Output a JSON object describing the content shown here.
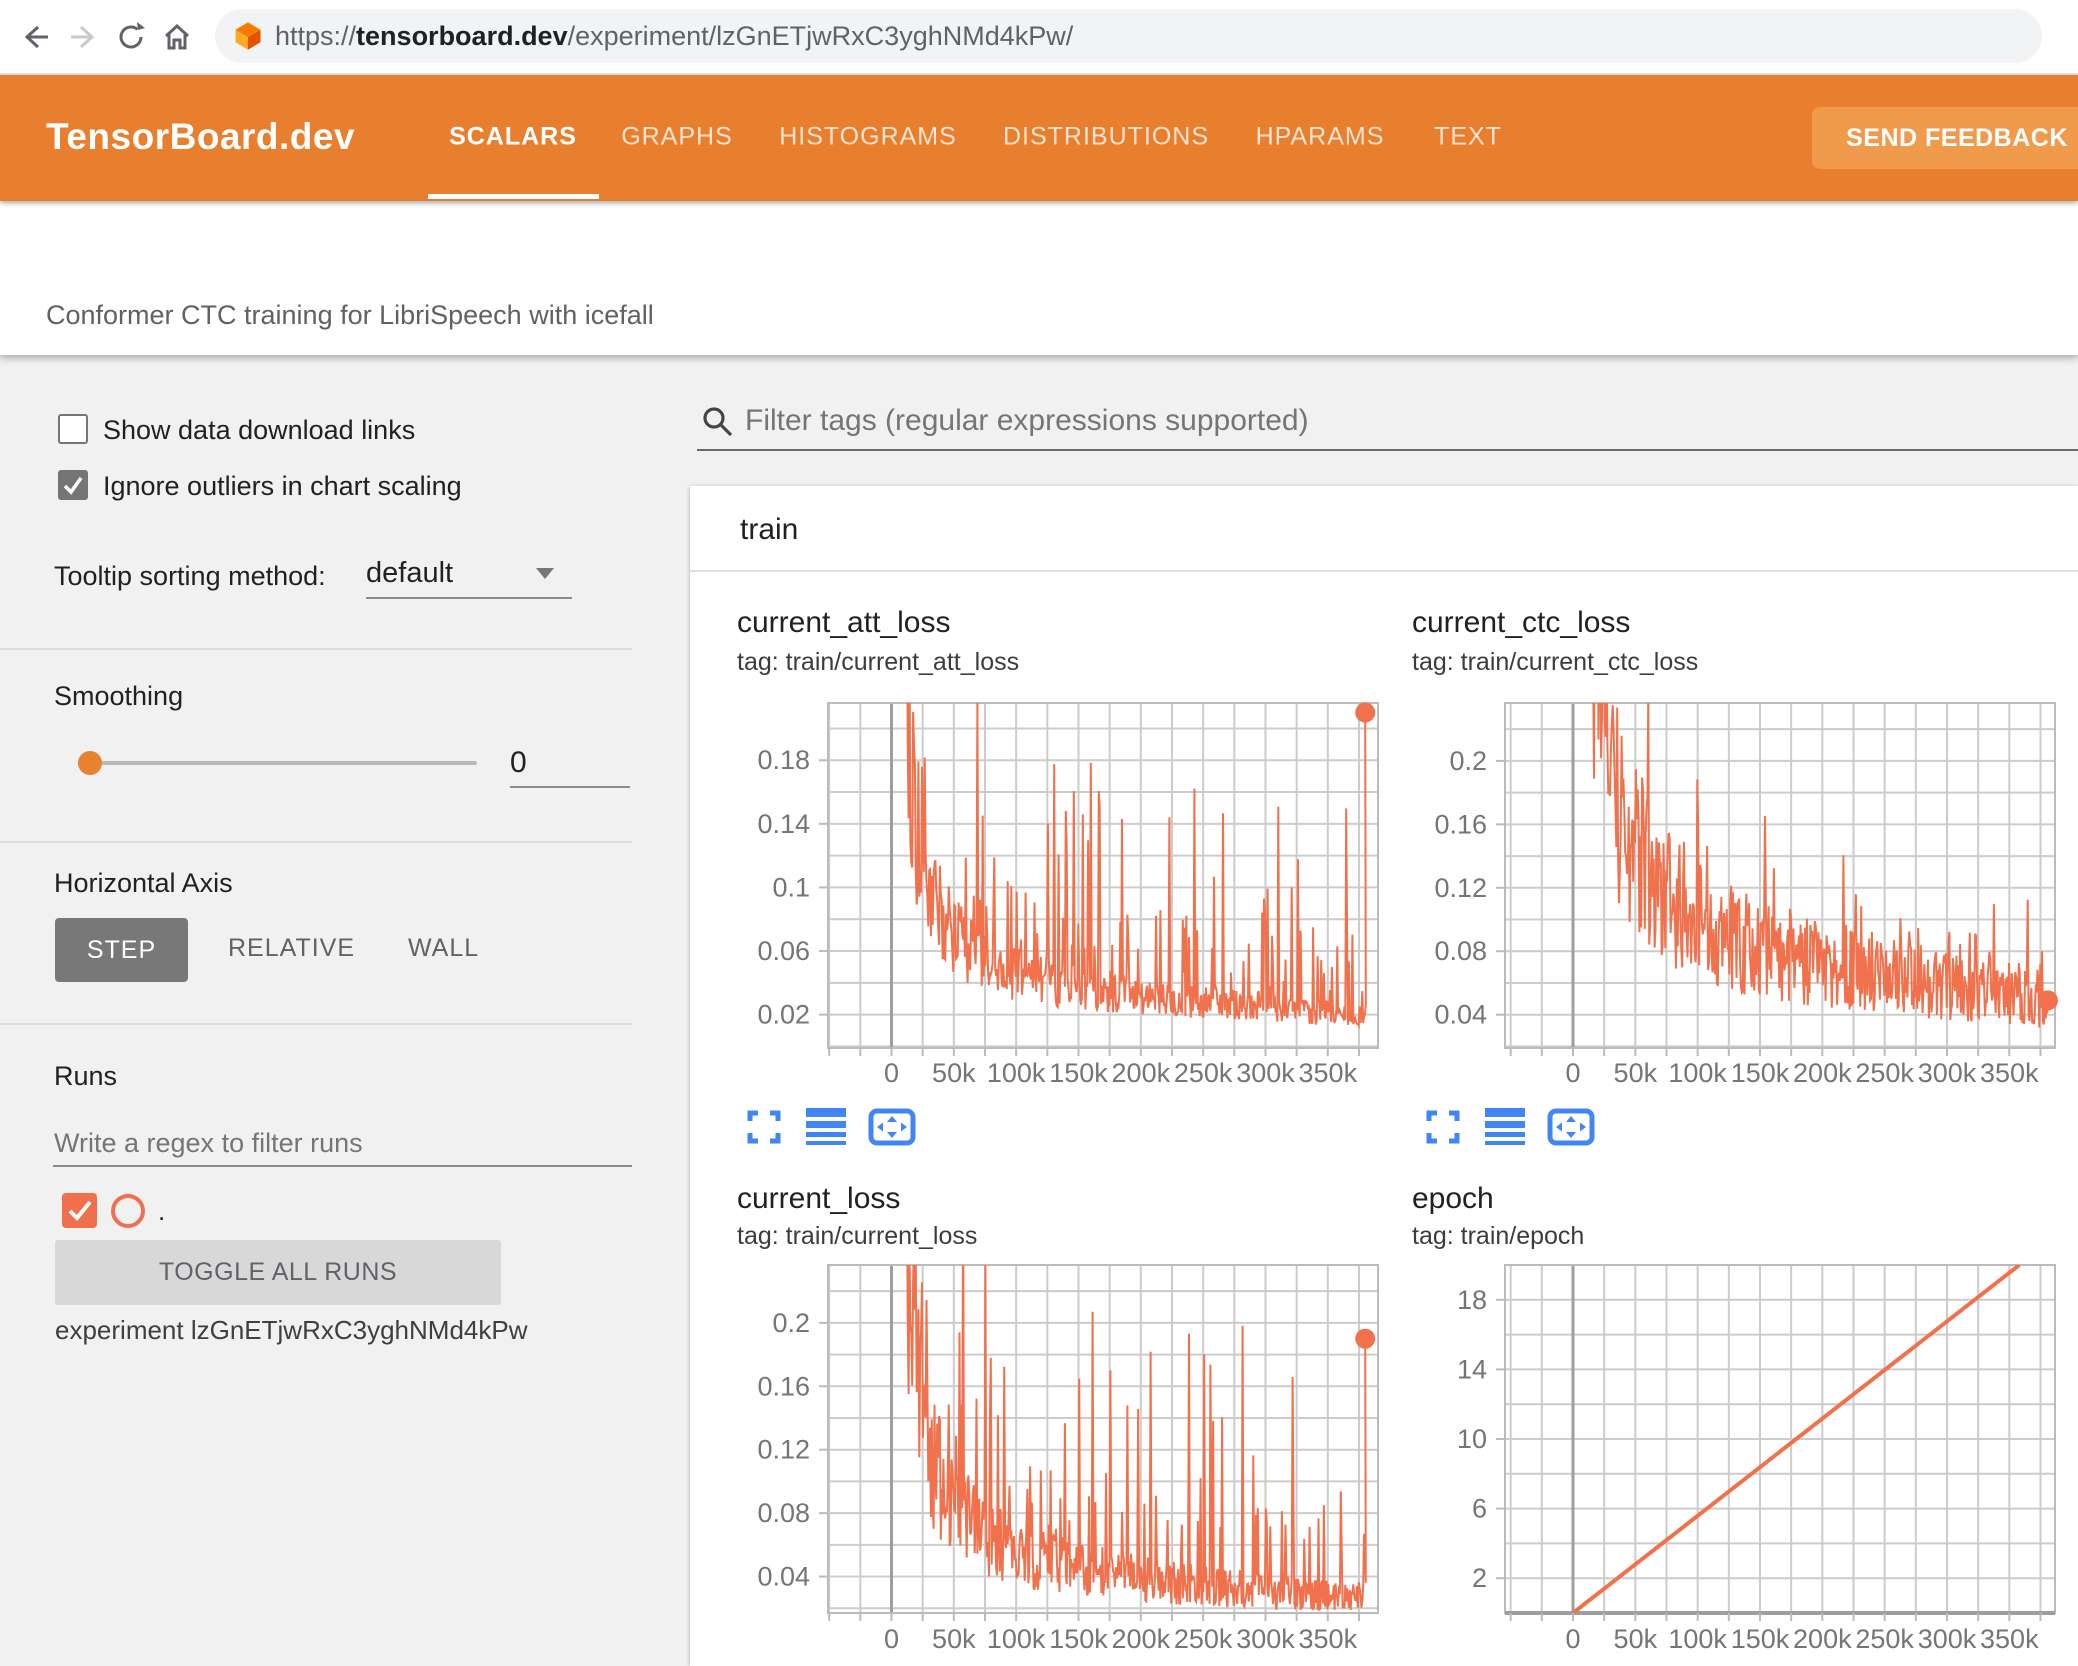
{
  "browser": {
    "url_scheme": "https://",
    "url_domain": "tensorboard.dev",
    "url_path": "/experiment/lzGnETjwRxC3yghNMd4kPw/"
  },
  "header": {
    "logo": "TensorBoard.dev",
    "tabs": [
      {
        "label": "SCALARS",
        "active": true
      },
      {
        "label": "GRAPHS",
        "active": false
      },
      {
        "label": "HISTOGRAMS",
        "active": false
      },
      {
        "label": "DISTRIBUTIONS",
        "active": false
      },
      {
        "label": "HPARAMS",
        "active": false
      },
      {
        "label": "TEXT",
        "active": false
      }
    ],
    "feedback_button": "SEND FEEDBACK"
  },
  "subtitle": "Conformer CTC training for LibriSpeech with icefall",
  "sidebar": {
    "show_download": {
      "label": "Show data download links",
      "checked": false
    },
    "ignore_outliers": {
      "label": "Ignore outliers in chart scaling",
      "checked": true
    },
    "tooltip_sorting": {
      "label": "Tooltip sorting method:",
      "value": "default"
    },
    "smoothing": {
      "label": "Smoothing",
      "value": "0"
    },
    "horizontal_axis": {
      "label": "Horizontal Axis",
      "options": [
        "STEP",
        "RELATIVE",
        "WALL"
      ],
      "selected": "STEP"
    },
    "runs": {
      "label": "Runs",
      "filter_placeholder": "Write a regex to filter runs",
      "run_name": ".",
      "run_checked": true,
      "toggle_button": "TOGGLE ALL RUNS",
      "experiment": "experiment lzGnETjwRxC3yghNMd4kPw"
    }
  },
  "main": {
    "filter_placeholder": "Filter tags (regular expressions supported)",
    "group_title": "train"
  },
  "colors": {
    "header_orange": "#e87f2e",
    "chart_line": "#f0714c",
    "icon_blue": "#4285f4",
    "grid": "#cccccc",
    "grid_border": "#bbbbbb",
    "zero_line": "#9e9e9e",
    "tick_text": "#757575"
  },
  "chart_data": [
    {
      "id": "current_att_loss",
      "title": "current_att_loss",
      "tag": "tag: train/current_att_loss",
      "type": "line",
      "legend_position": "none",
      "grid": true,
      "x_domain": [
        -55000,
        390000
      ],
      "x_tick_values": [
        0,
        50000,
        100000,
        150000,
        200000,
        250000,
        300000,
        350000
      ],
      "x_tick_labels": [
        "0",
        "50k",
        "100k",
        "150k",
        "200k",
        "250k",
        "300k",
        "350k"
      ],
      "x_grid_step": 25000,
      "y_domain": [
        -0.001,
        0.216
      ],
      "y_tick_values": [
        0.18,
        0.14,
        0.1,
        0.06,
        0.02
      ],
      "y_tick_labels": [
        "0.18",
        "0.14",
        "0.1",
        "0.06",
        "0.02"
      ],
      "y_grid_step": 0.02,
      "series": {
        "noisy": true,
        "start_step": 8000,
        "end_step": 380500,
        "trend": [
          [
            8000,
            0.4
          ],
          [
            12000,
            0.26
          ],
          [
            16000,
            0.175
          ],
          [
            22000,
            0.13
          ],
          [
            30000,
            0.1
          ],
          [
            40000,
            0.082
          ],
          [
            55000,
            0.065
          ],
          [
            70000,
            0.055
          ],
          [
            90000,
            0.048
          ],
          [
            115000,
            0.042
          ],
          [
            145000,
            0.037
          ],
          [
            180000,
            0.033
          ],
          [
            220000,
            0.029
          ],
          [
            260000,
            0.027
          ],
          [
            300000,
            0.024
          ],
          [
            340000,
            0.022
          ],
          [
            380500,
            0.021
          ]
        ],
        "spike_prob": 0.06,
        "spike_amp": 0.16,
        "floor": 0.005,
        "final_point": [
          380000,
          0.21
        ]
      }
    },
    {
      "id": "current_ctc_loss",
      "title": "current_ctc_loss",
      "tag": "tag: train/current_ctc_loss",
      "type": "line",
      "legend_position": "none",
      "grid": true,
      "x_domain": [
        -55000,
        390000
      ],
      "x_tick_values": [
        0,
        50000,
        100000,
        150000,
        200000,
        250000,
        300000,
        350000
      ],
      "x_tick_labels": [
        "0",
        "50k",
        "100k",
        "150k",
        "200k",
        "250k",
        "300k",
        "350k"
      ],
      "x_grid_step": 25000,
      "y_domain": [
        0.019,
        0.2365
      ],
      "y_tick_values": [
        0.2,
        0.16,
        0.12,
        0.08,
        0.04
      ],
      "y_tick_labels": [
        "0.2",
        "0.16",
        "0.12",
        "0.08",
        "0.04"
      ],
      "y_grid_step": 0.02,
      "series": {
        "noisy": true,
        "start_step": 9000,
        "end_step": 380500,
        "trend": [
          [
            9000,
            0.42
          ],
          [
            14000,
            0.3
          ],
          [
            20000,
            0.24
          ],
          [
            28000,
            0.195
          ],
          [
            38000,
            0.165
          ],
          [
            50000,
            0.145
          ],
          [
            65000,
            0.125
          ],
          [
            85000,
            0.108
          ],
          [
            110000,
            0.094
          ],
          [
            140000,
            0.084
          ],
          [
            175000,
            0.076
          ],
          [
            215000,
            0.069
          ],
          [
            260000,
            0.063
          ],
          [
            305000,
            0.058
          ],
          [
            345000,
            0.054
          ],
          [
            380500,
            0.05
          ]
        ],
        "spike_prob": 0.05,
        "spike_amp": 0.085,
        "floor": 0.021,
        "final_point": [
          381000,
          0.049
        ]
      }
    },
    {
      "id": "current_loss",
      "title": "current_loss",
      "tag": "tag: train/current_loss",
      "type": "line",
      "legend_position": "none",
      "grid": true,
      "x_domain": [
        -55000,
        390000
      ],
      "x_tick_values": [
        0,
        50000,
        100000,
        150000,
        200000,
        250000,
        300000,
        350000
      ],
      "x_tick_labels": [
        "0",
        "50k",
        "100k",
        "150k",
        "200k",
        "250k",
        "300k",
        "350k"
      ],
      "x_grid_step": 25000,
      "y_domain": [
        0.017,
        0.2365
      ],
      "y_tick_values": [
        0.2,
        0.16,
        0.12,
        0.08,
        0.04
      ],
      "y_tick_labels": [
        "0.2",
        "0.16",
        "0.12",
        "0.08",
        "0.04"
      ],
      "y_grid_step": 0.02,
      "series": {
        "noisy": true,
        "start_step": 8000,
        "end_step": 380500,
        "trend": [
          [
            8000,
            0.42
          ],
          [
            12000,
            0.28
          ],
          [
            16000,
            0.2
          ],
          [
            22000,
            0.155
          ],
          [
            30000,
            0.12
          ],
          [
            42000,
            0.095
          ],
          [
            58000,
            0.078
          ],
          [
            75000,
            0.066
          ],
          [
            95000,
            0.057
          ],
          [
            120000,
            0.05
          ],
          [
            150000,
            0.045
          ],
          [
            190000,
            0.04
          ],
          [
            230000,
            0.036
          ],
          [
            270000,
            0.033
          ],
          [
            310000,
            0.03
          ],
          [
            345000,
            0.028
          ],
          [
            380500,
            0.027
          ]
        ],
        "spike_prob": 0.06,
        "spike_amp": 0.17,
        "floor": 0.019,
        "final_point": [
          380000,
          0.19
        ]
      }
    },
    {
      "id": "epoch",
      "title": "epoch",
      "tag": "tag: train/epoch",
      "type": "line",
      "legend_position": "none",
      "grid": true,
      "x_domain": [
        -55000,
        390000
      ],
      "x_tick_values": [
        0,
        50000,
        100000,
        150000,
        200000,
        250000,
        300000,
        350000
      ],
      "x_tick_labels": [
        "0",
        "50k",
        "100k",
        "150k",
        "200k",
        "250k",
        "300k",
        "350k"
      ],
      "x_grid_step": 25000,
      "y_domain": [
        0,
        20.0
      ],
      "y_tick_values": [
        18,
        14,
        10,
        6,
        2
      ],
      "y_tick_labels": [
        "18",
        "14",
        "10",
        "6",
        "2"
      ],
      "y_grid_step": 2,
      "zero_axis": true,
      "series": {
        "noisy": false,
        "points": [
          [
            0,
            0
          ],
          [
            358000,
            20.0
          ]
        ]
      }
    }
  ]
}
